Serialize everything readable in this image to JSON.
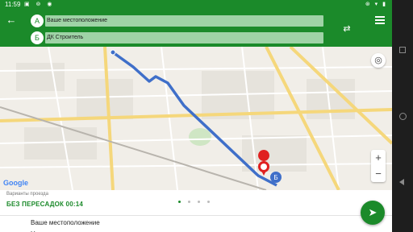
{
  "status": {
    "time": "11:59"
  },
  "route": {
    "from_badge": "А",
    "from_value": "Ваше местоположение",
    "to_badge": "Б",
    "to_value": "ДК Строитель"
  },
  "map": {
    "attribution": "Google",
    "origin_marker": "",
    "dest_marker": "Б"
  },
  "sheet": {
    "label": "Варианты проезда",
    "title": "БЕЗ ПЕРЕСАДОК 00:14",
    "steps": [
      "Ваше местоположение",
      "Н"
    ]
  },
  "colors": {
    "primary": "#1b8a2a",
    "route": "#3f6fc9",
    "marker": "#e02020"
  }
}
